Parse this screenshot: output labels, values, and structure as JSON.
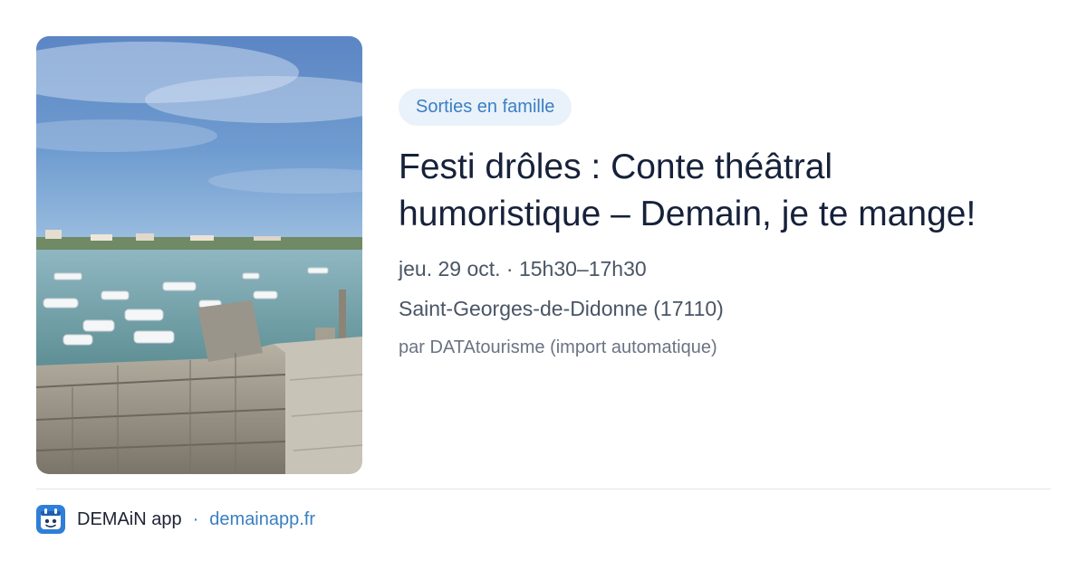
{
  "event": {
    "category": "Sorties en famille",
    "title": "Festi drôles : Conte théâtral humoristique – Demain, je te mange!",
    "datetime": "jeu. 29 oct. · 15h30–17h30",
    "location": "Saint-Georges-de-Didonne (17110)",
    "source": "par DATAtourisme (import automatique)"
  },
  "footer": {
    "app_name": "DEMAiN app",
    "separator": "·",
    "site": "demainapp.fr",
    "icon": "demain-app-icon"
  },
  "colors": {
    "tag_bg": "#e9f1fb",
    "accent": "#3a7fc1",
    "title": "#16213a",
    "meta": "#4a5565"
  }
}
